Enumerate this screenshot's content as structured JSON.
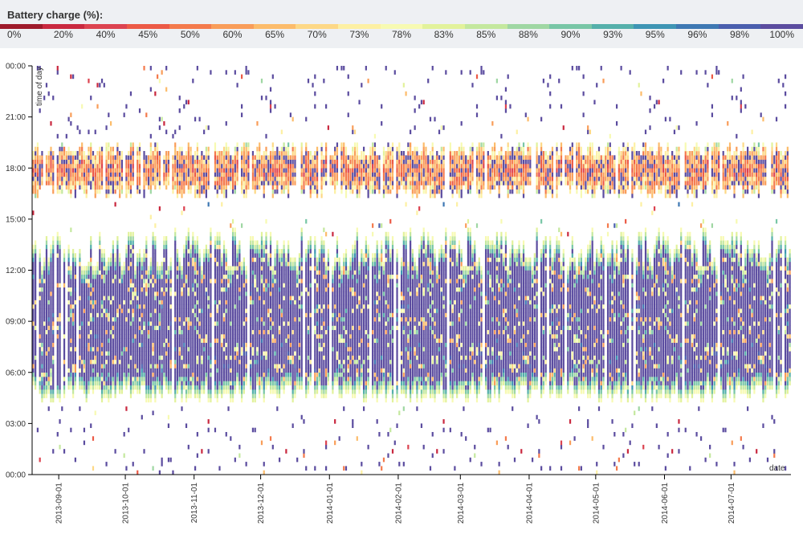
{
  "legend": {
    "title": "Battery charge (%):",
    "stops": [
      {
        "label": "0%",
        "color": "#9e1a2a"
      },
      {
        "label": "20%",
        "color": "#c9283f"
      },
      {
        "label": "40%",
        "color": "#dc4350"
      },
      {
        "label": "45%",
        "color": "#ec5a46"
      },
      {
        "label": "50%",
        "color": "#f47a4c"
      },
      {
        "label": "60%",
        "color": "#f99d59"
      },
      {
        "label": "65%",
        "color": "#fcbc6b"
      },
      {
        "label": "70%",
        "color": "#fdd886"
      },
      {
        "label": "73%",
        "color": "#fdf0a3"
      },
      {
        "label": "78%",
        "color": "#f7fab2"
      },
      {
        "label": "83%",
        "color": "#e2f29b"
      },
      {
        "label": "85%",
        "color": "#c4e89e"
      },
      {
        "label": "88%",
        "color": "#9fd7a3"
      },
      {
        "label": "90%",
        "color": "#78c6a6"
      },
      {
        "label": "93%",
        "color": "#55b0ab"
      },
      {
        "label": "95%",
        "color": "#3e95b4"
      },
      {
        "label": "96%",
        "color": "#3e78b3"
      },
      {
        "label": "98%",
        "color": "#4a5fae"
      },
      {
        "label": "100%",
        "color": "#5b4c9f"
      }
    ]
  },
  "chart_data": {
    "type": "heatmap",
    "title": "Battery charge (%):",
    "xlabel": "date",
    "ylabel": "time of day",
    "x_ticks": [
      "2013-09-01",
      "2013-10-01",
      "2013-11-01",
      "2013-12-01",
      "2014-01-01",
      "2014-02-01",
      "2014-03-01",
      "2014-04-01",
      "2014-05-01",
      "2014-06-01",
      "2014-07-01"
    ],
    "y_ticks": [
      "00:00",
      "03:00",
      "06:00",
      "09:00",
      "12:00",
      "15:00",
      "18:00",
      "21:00",
      "00:00"
    ],
    "x_range": [
      "2013-08-20",
      "2014-07-28"
    ],
    "y_range_hours": [
      0,
      24
    ],
    "pattern": {
      "night_charged_band_hours": [
        4.5,
        13.5
      ],
      "evening_discharge_band_hours": [
        16,
        19.5
      ],
      "typical_night_value": 100,
      "typical_evening_value": 55
    }
  }
}
